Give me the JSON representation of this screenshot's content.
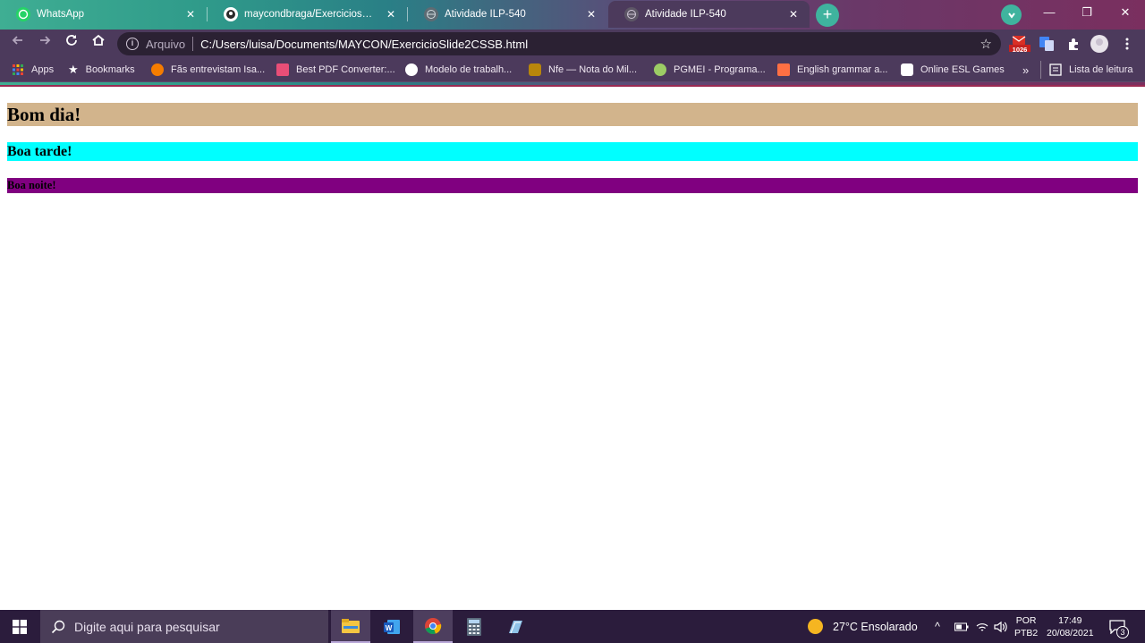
{
  "tabs": [
    {
      "title": "WhatsApp",
      "icon": "whatsapp-icon"
    },
    {
      "title": "maycondbraga/ExerciciosHTML: I",
      "icon": "github-icon"
    },
    {
      "title": "Atividade ILP-540",
      "icon": "globe-icon"
    },
    {
      "title": "Atividade ILP-540",
      "icon": "globe-icon",
      "active": true
    }
  ],
  "tab_close": "✕",
  "new_tab": "+",
  "window": {
    "minimize": "—",
    "restore": "❐",
    "close": "✕"
  },
  "address_bar": {
    "scheme_label": "Arquivo",
    "url": "C:/Users/luisa/Documents/MAYCON/ExercicioSlide2CSSB.html"
  },
  "extensions": {
    "mail_badge": "1026"
  },
  "bookmarks": [
    {
      "label": "Apps",
      "icon": "apps-grid-icon"
    },
    {
      "label": "Bookmarks",
      "icon": "star-icon"
    },
    {
      "label": "Fãs entrevistam Isa...",
      "icon": "site-icon"
    },
    {
      "label": "Best PDF Converter:...",
      "icon": "pdf-icon"
    },
    {
      "label": "Modelo de trabalh...",
      "icon": "globe-icon"
    },
    {
      "label": "Nfe — Nota do Mil...",
      "icon": "crest-icon"
    },
    {
      "label": "PGMEI - Programa...",
      "icon": "site-icon"
    },
    {
      "label": "English grammar a...",
      "icon": "site-icon"
    },
    {
      "label": "Online ESL Games",
      "icon": "site-icon"
    }
  ],
  "bookmarks_more": "»",
  "reading_list": "Lista de leitura",
  "page": {
    "h1": "Bom dia!",
    "h2": "Boa tarde!",
    "h3": "Boa noite!",
    "colors": {
      "h1": "#d2b48c",
      "h2": "#00ffff",
      "h3": "#800080"
    }
  },
  "taskbar": {
    "search_placeholder": "Digite aqui para pesquisar",
    "weather": "27°C  Ensolarado",
    "lang_top": "POR",
    "lang_bottom": "PTB2",
    "time": "17:49",
    "date": "20/08/2021",
    "notifications": "3"
  }
}
